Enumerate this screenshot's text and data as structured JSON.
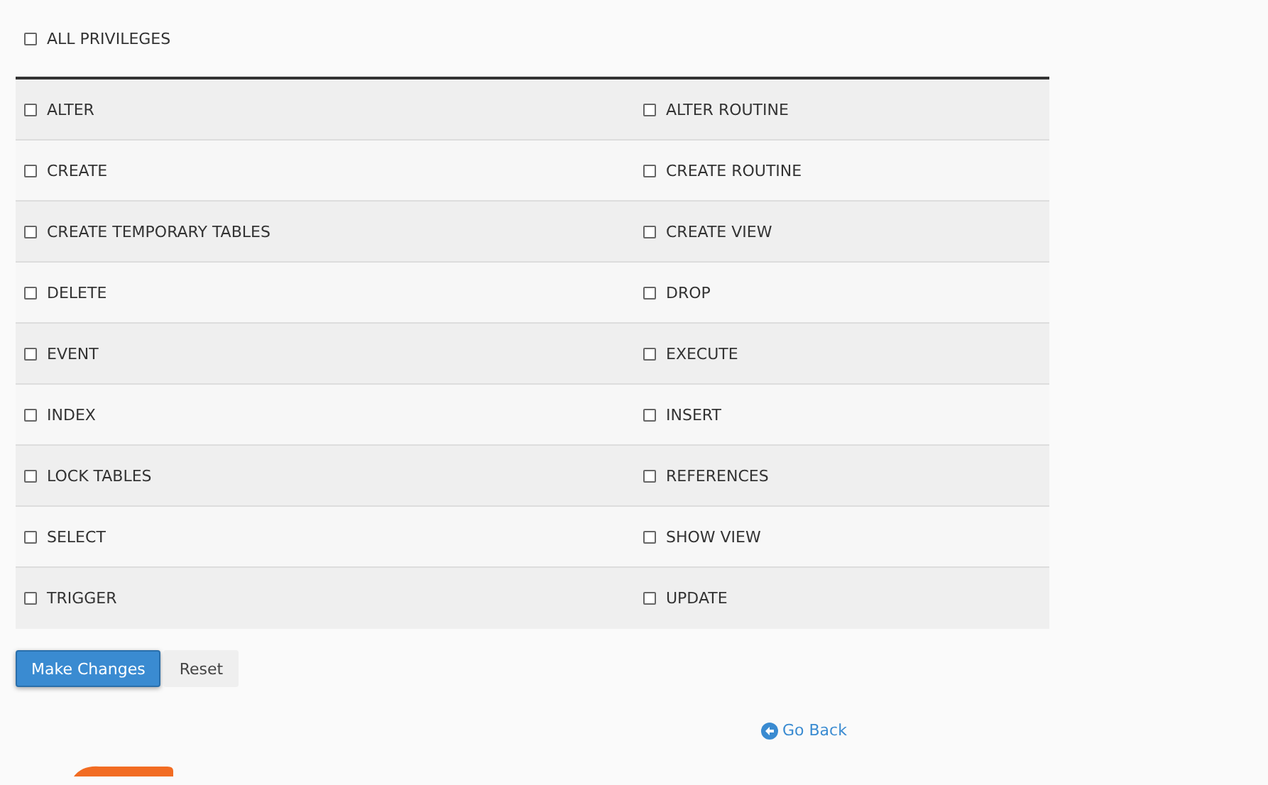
{
  "all_privileges": {
    "label": "ALL PRIVILEGES",
    "checked": false
  },
  "privileges": [
    [
      {
        "label": "ALTER",
        "checked": false
      },
      {
        "label": "ALTER ROUTINE",
        "checked": false
      }
    ],
    [
      {
        "label": "CREATE",
        "checked": false
      },
      {
        "label": "CREATE ROUTINE",
        "checked": false
      }
    ],
    [
      {
        "label": "CREATE TEMPORARY TABLES",
        "checked": false
      },
      {
        "label": "CREATE VIEW",
        "checked": false
      }
    ],
    [
      {
        "label": "DELETE",
        "checked": false
      },
      {
        "label": "DROP",
        "checked": false
      }
    ],
    [
      {
        "label": "EVENT",
        "checked": false
      },
      {
        "label": "EXECUTE",
        "checked": false
      }
    ],
    [
      {
        "label": "INDEX",
        "checked": false
      },
      {
        "label": "INSERT",
        "checked": false
      }
    ],
    [
      {
        "label": "LOCK TABLES",
        "checked": false
      },
      {
        "label": "REFERENCES",
        "checked": false
      }
    ],
    [
      {
        "label": "SELECT",
        "checked": false
      },
      {
        "label": "SHOW VIEW",
        "checked": false
      }
    ],
    [
      {
        "label": "TRIGGER",
        "checked": false
      },
      {
        "label": "UPDATE",
        "checked": false
      }
    ]
  ],
  "buttons": {
    "primary": "Make Changes",
    "secondary": "Reset"
  },
  "go_back": "Go Back"
}
